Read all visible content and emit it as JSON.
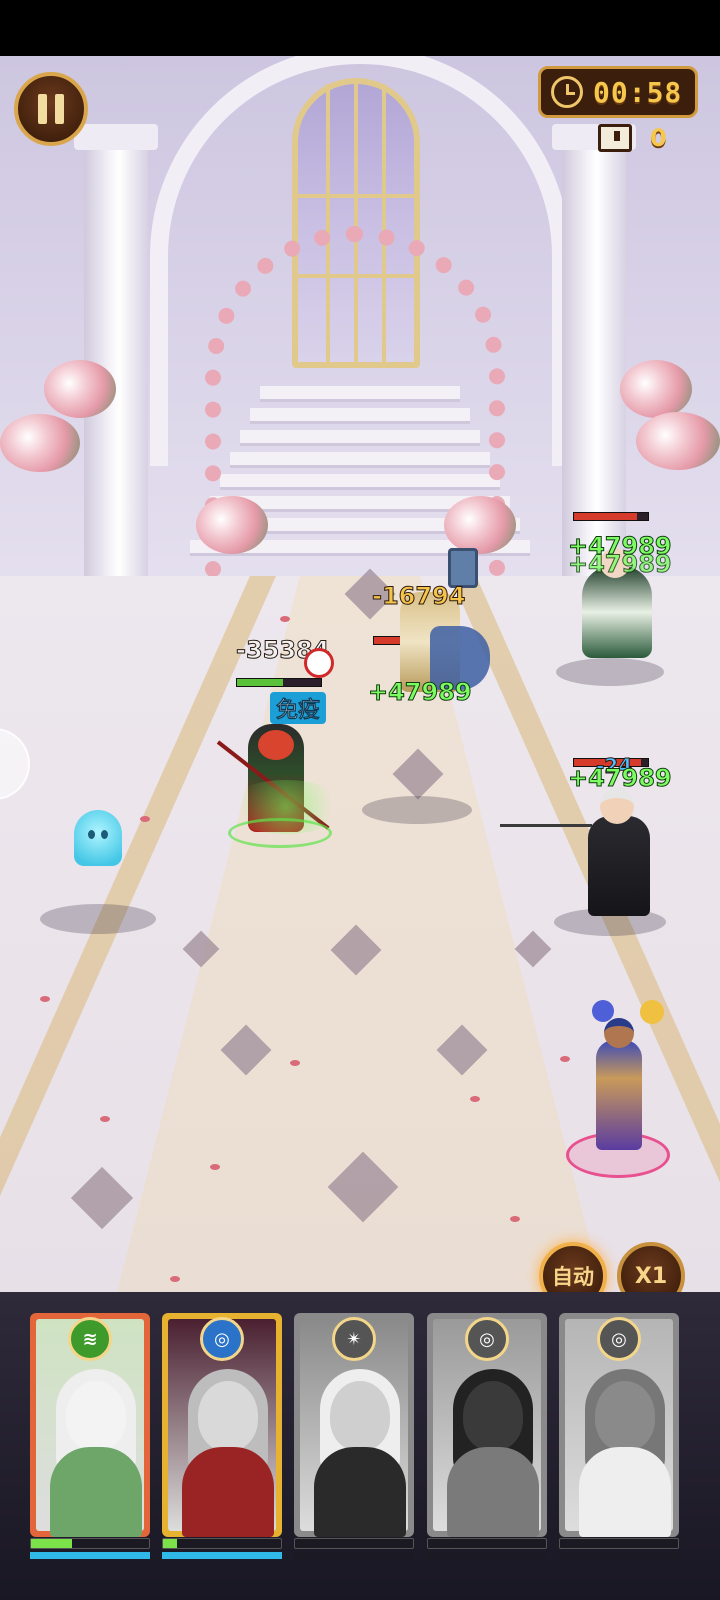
{
  "hud": {
    "timer": "00:58",
    "chest_count": "0",
    "auto_label": "自动",
    "speed_label": "X1"
  },
  "combat_text": {
    "enemy_top_right_heal_1": "+47989",
    "enemy_top_right_heal_2": "+47989",
    "enemy_hammer_damage": "-16794",
    "enemy_hammer_heal": "+47989",
    "hero_red_damage": "-35384",
    "hero_red_buff": "免疫",
    "enemy_mid_right_damage": "-24",
    "enemy_mid_right_heal": "+47989"
  },
  "hp": {
    "enemy_top_right": 0.85,
    "enemy_hammer": 0.8,
    "hero_red": 0.55,
    "enemy_mid_right": 0.9
  },
  "cards": [
    {
      "name": "green-maiden",
      "element": "wind",
      "emblem_color": "#3f9a2c",
      "frame_color": "#e2663a",
      "active": true,
      "energy": 0.35,
      "mana": 1.0
    },
    {
      "name": "red-armored-hero",
      "element": "water",
      "emblem_color": "#2a73c8",
      "frame_color": "#e6b230",
      "active": true,
      "energy": 0.12,
      "mana": 1.0
    },
    {
      "name": "old-gentleman",
      "element": "arcane",
      "emblem_color": "#555555",
      "frame_color": "#8a8a8a",
      "active": false,
      "energy": 0,
      "mana": 0
    },
    {
      "name": "dark-haired-lady",
      "element": "water",
      "emblem_color": "#555555",
      "frame_color": "#8a8a8a",
      "active": false,
      "energy": 0,
      "mana": 0
    },
    {
      "name": "schoolgirl",
      "element": "water",
      "emblem_color": "#555555",
      "frame_color": "#8a8a8a",
      "active": false,
      "energy": 0,
      "mana": 0
    }
  ],
  "colors": {
    "hp_enemy": "#d63a2a",
    "hp_ally": "#59c23a",
    "mana": "#2fb8e8",
    "heal_text": "#7dfc62",
    "gold_text": "#f6c44a"
  }
}
